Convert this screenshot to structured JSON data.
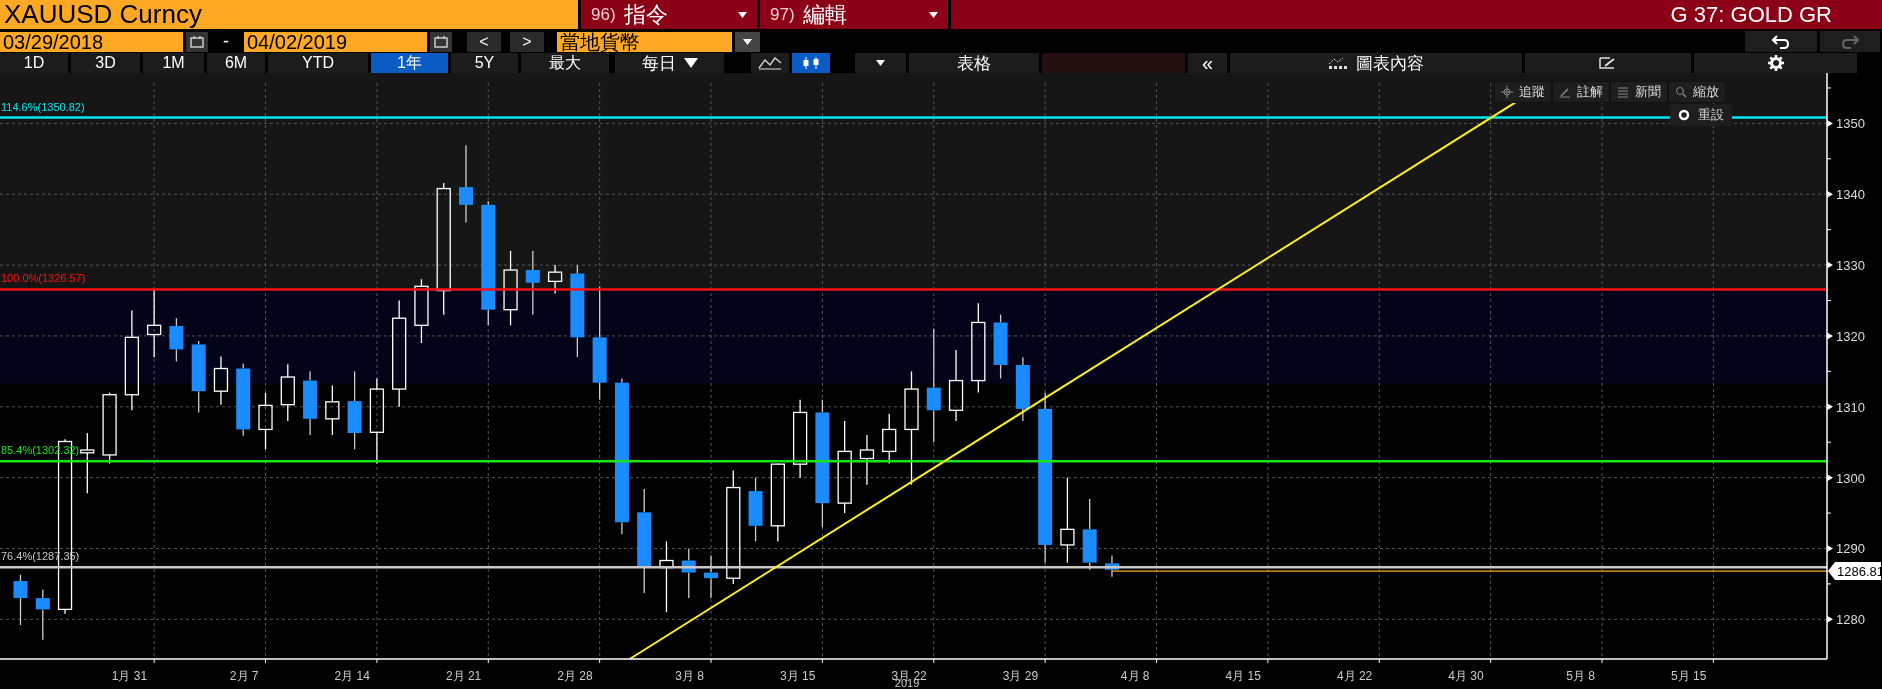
{
  "header": {
    "security": "XAUUSD Curncy",
    "menus": [
      {
        "number": "96)",
        "label": "指令"
      },
      {
        "number": "97)",
        "label": "編輯"
      }
    ],
    "page_title": "G 37: GOLD GR"
  },
  "range": {
    "start": "03/29/2018",
    "separator": "-",
    "end": "04/02/2019",
    "prev": "<",
    "next": ">",
    "currency": "當地貨幣"
  },
  "history": [
    {
      "kind": "undo",
      "disabled": false
    },
    {
      "kind": "redo",
      "disabled": true
    }
  ],
  "toolbar": {
    "periods": [
      {
        "label": "1D",
        "selected": false
      },
      {
        "label": "3D",
        "selected": false
      },
      {
        "label": "1M",
        "selected": false
      },
      {
        "label": "6M",
        "selected": false
      },
      {
        "label": "YTD",
        "selected": false
      },
      {
        "label": "1年",
        "selected": true
      },
      {
        "label": "5Y",
        "selected": false
      },
      {
        "label": "最大",
        "selected": false
      }
    ],
    "frequency": "每日",
    "chart_types": [
      {
        "kind": "line",
        "selected": false
      },
      {
        "kind": "candle",
        "selected": true
      }
    ],
    "table": "表格",
    "collapse": "«",
    "content": "圖表內容"
  },
  "chart_tools": [
    {
      "kind": "crosshair",
      "label": "追蹤"
    },
    {
      "kind": "annotate",
      "label": "註解"
    },
    {
      "kind": "news",
      "label": "新聞"
    },
    {
      "kind": "zoom",
      "label": "縮放"
    }
  ],
  "reset": "重設",
  "chart": {
    "levels": [
      {
        "label": "114.6%(1350.82)",
        "color": "#00e5ee"
      },
      {
        "label": "100.0%(1326.57)",
        "color": "#ff1010"
      },
      {
        "label": "85.4%(1302.32)",
        "color": "#19e619"
      },
      {
        "label": "76.4%(1287.35)",
        "color": "#c8c8c8"
      }
    ],
    "last_price": "1286.81",
    "y_ticks": [
      "1350",
      "1340",
      "1330",
      "1320",
      "1310",
      "1300",
      "1290",
      "1280"
    ],
    "x_ticks": [
      "1月 31",
      "2月 7",
      "2月 14",
      "2月 21",
      "2月 28",
      "3月 8",
      "3月 15",
      "3月 22",
      "3月 29",
      "4月 8",
      "4月 15",
      "4月 22",
      "4月 30",
      "5月 8",
      "5月 15"
    ],
    "year": "2019"
  }
}
